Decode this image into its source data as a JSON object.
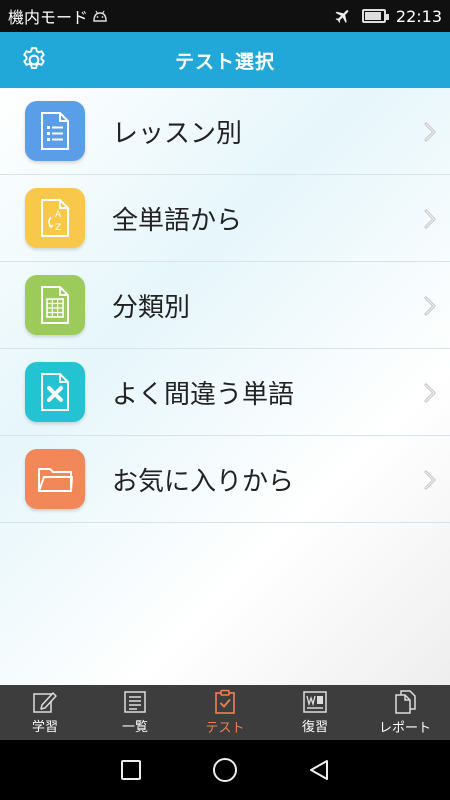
{
  "status_bar": {
    "carrier": "機内モード",
    "time": "22:13",
    "icons": [
      "android-icon",
      "airplane-icon",
      "battery-icon"
    ]
  },
  "header": {
    "title": "テスト選択",
    "settings_icon": "gear-icon"
  },
  "menu": {
    "items": [
      {
        "label": "レッスン別",
        "icon": "document-list-icon",
        "color": "#5b9ee8"
      },
      {
        "label": "全単語から",
        "icon": "a-to-z-icon",
        "color": "#f7c84a"
      },
      {
        "label": "分類別",
        "icon": "grid-sheet-icon",
        "color": "#9ccb5b"
      },
      {
        "label": "よく間違う単語",
        "icon": "document-x-icon",
        "color": "#23c3d1"
      },
      {
        "label": "お気に入りから",
        "icon": "folder-icon",
        "color": "#f2875a"
      }
    ]
  },
  "tab_bar": {
    "active_color": "#f07f54",
    "tabs": [
      {
        "label": "学習",
        "icon": "pencil-edit-icon"
      },
      {
        "label": "一覧",
        "icon": "list-icon"
      },
      {
        "label": "テスト",
        "icon": "clipboard-check-icon",
        "active": true
      },
      {
        "label": "復習",
        "icon": "review-card-icon"
      },
      {
        "label": "レポート",
        "icon": "report-pages-icon"
      }
    ]
  },
  "system_nav": {
    "buttons": [
      "recents-square-icon",
      "home-circle-icon",
      "back-triangle-icon"
    ]
  },
  "colors": {
    "header": "#22a8d8",
    "tab_bar": "#3d3d3d"
  }
}
